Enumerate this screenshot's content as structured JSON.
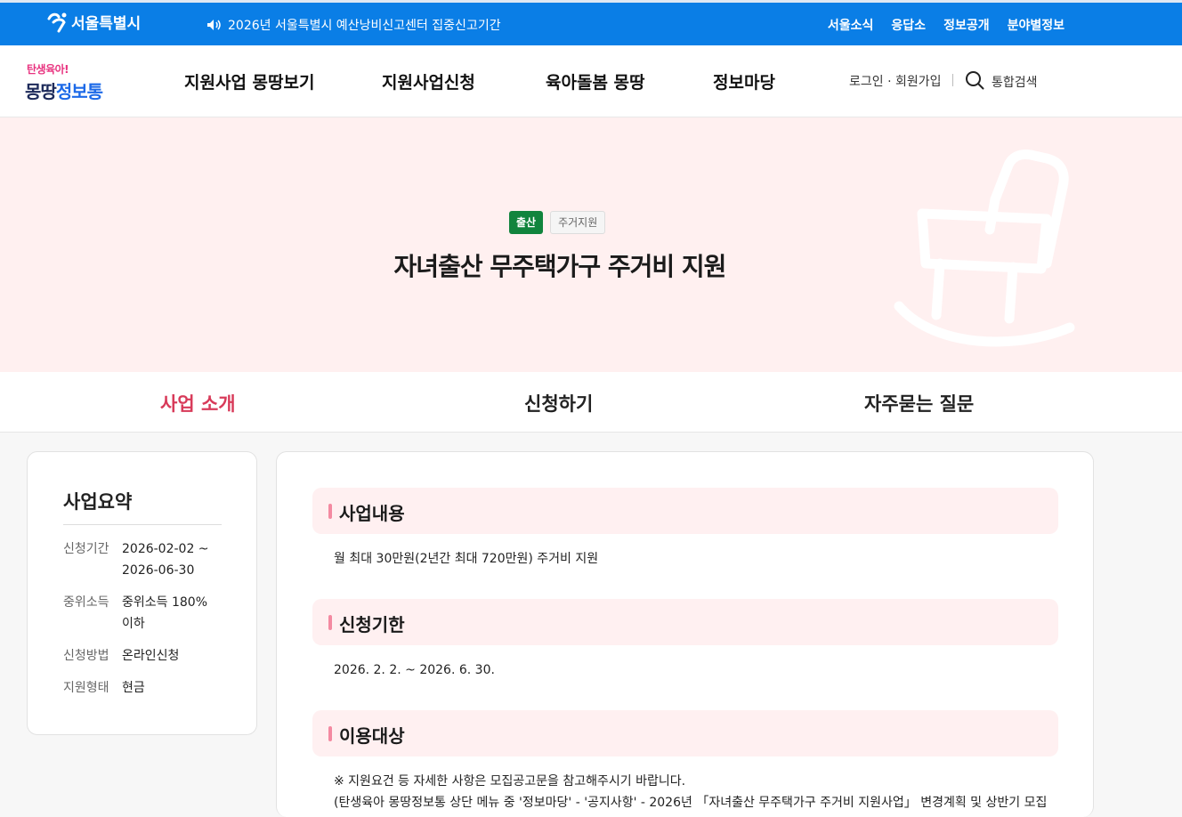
{
  "topbar": {
    "logo_text": "서울특별시",
    "notice": "2026년 서울특별시 예산낭비신고센터 집중신고기간",
    "util_menu": [
      "서울소식",
      "응답소",
      "정보공개",
      "분야별정보"
    ]
  },
  "header": {
    "brand_sub": "탄생육아!",
    "brand_main_a": "몽땅",
    "brand_main_b": "정보통",
    "gnb": [
      "지원사업 몽땅보기",
      "지원사업신청",
      "육아돌봄 몽땅",
      "정보마당"
    ],
    "login": "로그인 · 회원가입",
    "search": "통합검색"
  },
  "hero": {
    "badge_primary": "출산",
    "badge_secondary": "주거지원",
    "title": "자녀출산 무주택가구 주거비 지원"
  },
  "tabs": [
    "사업 소개",
    "신청하기",
    "자주묻는 질문"
  ],
  "summary": {
    "title": "사업요약",
    "rows": [
      {
        "k": "신청기간",
        "v": "2026-02-02 ~ 2026-06-30"
      },
      {
        "k": "중위소득",
        "v": "중위소득 180% 이하"
      },
      {
        "k": "신청방법",
        "v": "온라인신청"
      },
      {
        "k": "지원형태",
        "v": "현금"
      }
    ]
  },
  "sections": [
    {
      "title": "사업내용",
      "body": "월 최대 30만원(2년간 최대 720만원) 주거비 지원"
    },
    {
      "title": "신청기한",
      "body": "2026. 2. 2. ~ 2026. 6. 30."
    },
    {
      "title": "이용대상",
      "body": "※ 지원요건 등 자세한 사항은 모집공고문을 참고해주시기 바랍니다.",
      "body2": "(탄생육아 몽땅정보통 상단 메뉴 중 '정보마당' - '공지사항' - 2026년 「자녀출산 무주택가구 주거비 지원사업」 변경계획 및 상반기 모집"
    }
  ],
  "colors": {
    "topbar": "#0a7ee6",
    "hero_bg": "#fff0f0",
    "tab_active": "#d83b5a",
    "badge_green": "#11843d"
  }
}
